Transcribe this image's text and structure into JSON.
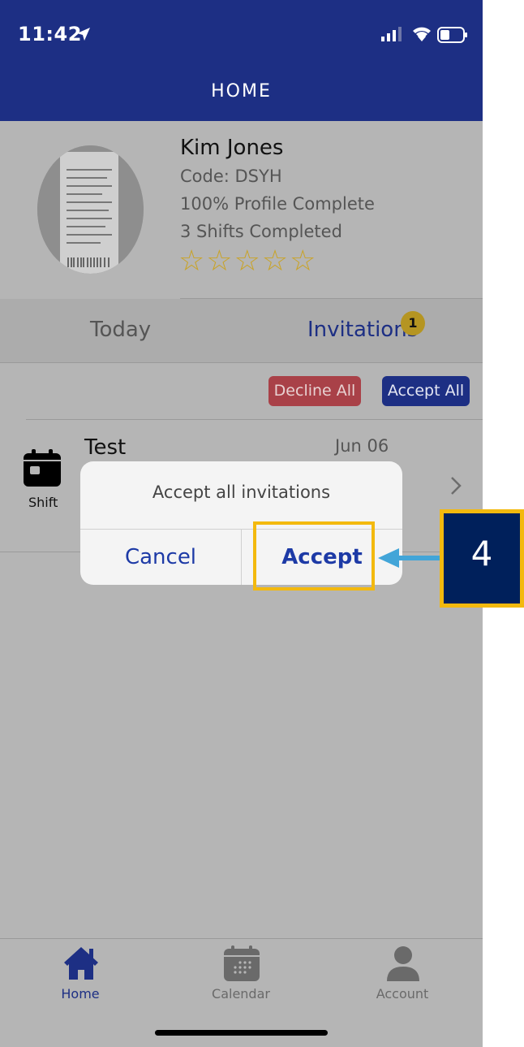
{
  "status_bar": {
    "time": "11:42"
  },
  "header": {
    "title": "HOME"
  },
  "profile": {
    "name": "Kim Jones",
    "code": "Code: DSYH",
    "completion": "100% Profile Complete",
    "shifts": "3 Shifts Completed",
    "rating_stars_filled": 0,
    "rating_stars_total": 5
  },
  "tabs": {
    "today": "Today",
    "invitations": "Invitations",
    "invitations_badge": "1"
  },
  "actions": {
    "decline_all": "Decline All",
    "accept_all": "Accept All"
  },
  "shift_row": {
    "icon_label": "Shift",
    "title": "Test",
    "date": "Jun 06"
  },
  "dialog": {
    "message": "Accept all invitations",
    "cancel": "Cancel",
    "accept": "Accept"
  },
  "annotation": {
    "step": "4"
  },
  "bottom_nav": [
    {
      "label": "Home",
      "icon": "home-icon",
      "active": true
    },
    {
      "label": "Calendar",
      "icon": "calendar-icon",
      "active": false
    },
    {
      "label": "Account",
      "icon": "account-icon",
      "active": false
    }
  ],
  "colors": {
    "brand": "#1d2f84",
    "decline": "#a94148",
    "star": "#c9a326",
    "highlight": "#f3b90e",
    "step_box": "#00205b",
    "arrow": "#42a5d8"
  }
}
